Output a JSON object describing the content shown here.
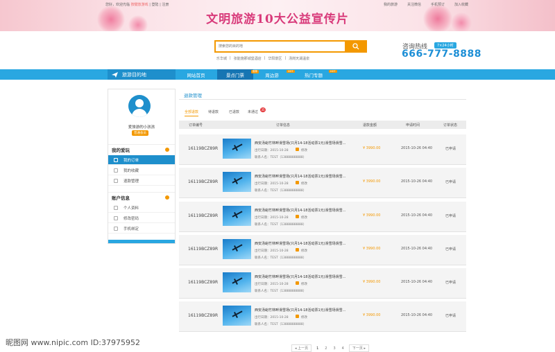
{
  "topbar": {
    "welcome": "您好，欢迎光临",
    "login_link": "按键放游戏",
    "register": "登陆",
    "separator": "|",
    "signup": "注册",
    "right_items": [
      "我的旅游",
      "关注微信",
      "手机预订",
      "加入收藏"
    ]
  },
  "banner": {
    "title": "文明旅游10大公益宣传片"
  },
  "search": {
    "placeholder": "搜索您的目的地",
    "hot_words": [
      "乐华城",
      "张能施那城堡酒店",
      "华阳景区",
      "汤岗天湖温泉"
    ]
  },
  "hotline": {
    "label": "咨询热线",
    "badge": "7×24小时",
    "number": "666-777-8888"
  },
  "nav": {
    "destination": "旅游目的地",
    "items": [
      "网站首页",
      "景点门票",
      "周边游",
      "热门专题"
    ],
    "tags": [
      "推荐",
      "HOT",
      "HOT"
    ]
  },
  "sidebar": {
    "username": "爱旅游的小孩孩",
    "member_badge": "普通会员",
    "section1": "我的爱玩",
    "section1_items": [
      "我的订单",
      "我的收藏",
      "退款管理"
    ],
    "section2": "账户信息",
    "section2_items": [
      "个人资料",
      "修改密码",
      "手机绑定"
    ]
  },
  "content": {
    "title": "退款管理",
    "tabs": [
      "全部退款",
      "待退款",
      "已退款",
      "未通过"
    ],
    "tab_badge": "35",
    "headers": [
      "订单编号",
      "订单信息",
      "退款金额",
      "申请时间",
      "订单状态"
    ]
  },
  "orders": [
    {
      "order_no": "16119BCZ89R",
      "title": "西安汤峪竹林畔滑雪场(只月14-18活动票1元)滑雪场滑雪...",
      "date_label": "出行日期：",
      "date": "2015-10-28",
      "change": "修改",
      "contact": "联系人名：TEST（13888888888）",
      "amount": "¥ 3990.00",
      "apply_time": "2015-10-26 04:40",
      "status": "已申请"
    },
    {
      "order_no": "16119BCZ89R",
      "title": "西安汤峪竹林畔滑雪场(只月14-18活动票1元)滑雪场滑雪...",
      "date_label": "出行日期：",
      "date": "2015-10-28",
      "change": "修改",
      "contact": "联系人名：TEST（13888888888）",
      "amount": "¥ 3990.00",
      "apply_time": "2015-10-26 04:40",
      "status": "已申请"
    },
    {
      "order_no": "16119BCZ89R",
      "title": "西安汤峪竹林畔滑雪场(只月14-18活动票1元)滑雪场滑雪...",
      "date_label": "出行日期：",
      "date": "2015-10-28",
      "change": "修改",
      "contact": "联系人名：TEST（13888888888）",
      "amount": "¥ 3990.00",
      "apply_time": "2015-10-26 04:40",
      "status": "已申请"
    },
    {
      "order_no": "16119BCZ89R",
      "title": "西安汤峪竹林畔滑雪场(只月14-18活动票1元)滑雪场滑雪...",
      "date_label": "出行日期：",
      "date": "2015-10-28",
      "change": "修改",
      "contact": "联系人名：TEST（13888888888）",
      "amount": "¥ 3990.00",
      "apply_time": "2015-10-26 04:40",
      "status": "已申请"
    },
    {
      "order_no": "16119BCZ89R",
      "title": "西安汤峪竹林畔滑雪场(只月14-18活动票1元)滑雪场滑雪...",
      "date_label": "出行日期：",
      "date": "2015-10-28",
      "change": "修改",
      "contact": "联系人名：TEST（13888888888）",
      "amount": "¥ 3990.00",
      "apply_time": "2015-10-26 04:40",
      "status": "已申请"
    },
    {
      "order_no": "16119BCZ89R",
      "title": "西安汤峪竹林畔滑雪场(只月14-18活动票1元)滑雪场滑雪...",
      "date_label": "出行日期：",
      "date": "2015-10-28",
      "change": "修改",
      "contact": "联系人名：TEST（13888888888）",
      "amount": "¥ 3990.00",
      "apply_time": "2015-10-26 04:40",
      "status": "已申请"
    }
  ],
  "pagination": {
    "prev": "◂ 上一页",
    "pages": [
      "1",
      "2",
      "3",
      "4"
    ],
    "current": "1",
    "next": "下一页 ▸"
  },
  "watermark": "昵图网 www.nipic.com  ID:37975952",
  "colors": {
    "primary": "#29a7e1",
    "accent": "#f39800",
    "nav_dark": "#1e8fcc",
    "banner_text": "#d83a7a"
  },
  "icons": [
    "search-icon",
    "plane-icon",
    "user-avatar-icon",
    "edit-icon"
  ]
}
